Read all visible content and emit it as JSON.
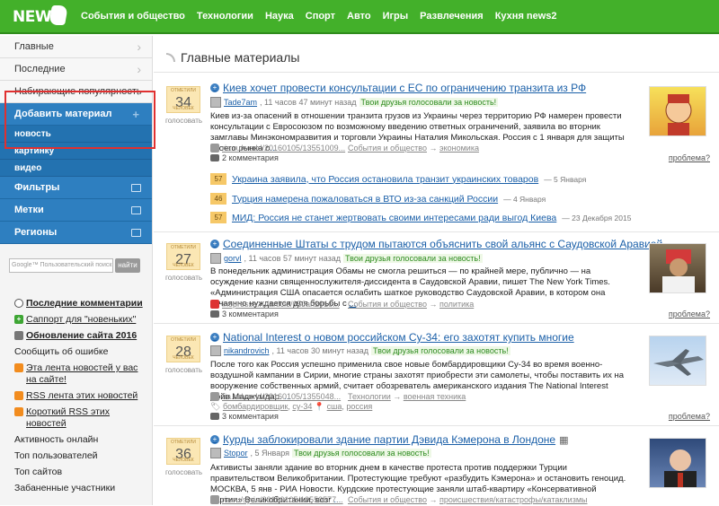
{
  "brand": {
    "logo_text": "NEWS",
    "accent": "#43b02a"
  },
  "nav": [
    "События и общество",
    "Технологии",
    "Наука",
    "Спорт",
    "Авто",
    "Игры",
    "Развлечения",
    "Кухня news2"
  ],
  "sidebar": {
    "items": [
      "Главные",
      "Последние",
      "Набирающие популярность"
    ],
    "add_material": "Добавить материал",
    "add_sub": [
      "новость",
      "картинку",
      "видео"
    ],
    "sections": [
      "Фильтры",
      "Метки",
      "Регионы"
    ],
    "search_placeholder": "Google™ Пользовательский поиск",
    "search_button": "найти",
    "links": [
      {
        "icon": "comment-icon",
        "label": "Последние комментарии",
        "bold": true
      },
      {
        "icon": "plus-icon",
        "label": "Саппорт для \"новеньких\"",
        "bold": false
      },
      {
        "icon": "document-icon",
        "label": "Обновление сайта 2016",
        "bold": true
      },
      {
        "icon": "",
        "label": "Сообщить об ошибке",
        "bold": false
      },
      {
        "icon": "rss-icon",
        "label": "Эта лента новостей у вас на сайте!",
        "bold": false
      },
      {
        "icon": "rss-icon",
        "label": "RSS лента этих новостей",
        "bold": false
      },
      {
        "icon": "rss-icon",
        "label": "Короткий RSS этих новостей",
        "bold": false
      },
      {
        "icon": "",
        "label": "Активность онлайн",
        "bold": false
      },
      {
        "icon": "",
        "label": "Топ пользователей",
        "bold": false
      },
      {
        "icon": "",
        "label": "Топ сайтов",
        "bold": false
      },
      {
        "icon": "",
        "label": "Забаненные участники",
        "bold": false
      }
    ]
  },
  "main": {
    "title": "Главные материалы",
    "vote_label": "голосовать",
    "vote_sup": "ОТМЕТИЛИ",
    "vote_sub": "ЧЕЛОВЕК",
    "friends_text": "Твои друзья голосовали за новость!",
    "problem_label": "проблема?",
    "articles": [
      {
        "votes": "34",
        "title": "Киев хочет провести консультации с ЕС по ограничению транзита из РФ",
        "user": "Tade7am",
        "time": ", 11 часов 47 минут назад",
        "body": "Киев из-за опасений в отношении транзита грузов из Украины через территорию РФ намерен провести консультации с Евросоюзом по возможному введению ответных ограничений, заявила во вторник замглавы Минэкономразвития и торговли Украины Наталия Микольская. Россия с 1 января для защиты своего рынка о",
        "more": "...",
        "source": "ria.ru/world/20160105/13551009...",
        "cat1": "События и общество",
        "arrow": "→",
        "cat2": "экономика",
        "tags": "",
        "comments": "2 комментария",
        "problem": "проблема?"
      },
      {
        "votes": "27",
        "title": "Соединенные Штаты с трудом пытаются объяснить свой альянс с Саудовской Аравией",
        "user": "gorvl",
        "time": ", 11 часов 57 минут назад",
        "body": "В понедельник администрация Обамы не смогла решиться — по крайней мере, публично — на осуждение казни священнослужителя-диссидента в Саудовской Аравии, пишет The New York Times. «Администрация США опасается ослабить шаткое руководство Саудовской Аравии, в котором она отчаянно нуждается для борьбы с",
        "more": "...",
        "source": "inopressa.ru/article/05Jan2016...",
        "cat1": "События и общество",
        "arrow": "→",
        "cat2": "политика",
        "tags": "",
        "comments": "3 комментария",
        "problem": "проблема?"
      },
      {
        "votes": "28",
        "title": "National Interest о новом российском Су-34: его захотят купить многие",
        "user": "nikandrovich",
        "time": ", 11 часов 30 минут назад",
        "body": "После того как Россия успешно применила свое новые бомбардировщики Су-34 во время военно-воздушной кампании в Сирии, многие страны захотят приобрести эти самолеты, чтобы поставить их на вооружение собственных армий, считает обозреватель американского издания The National Interest Дэйв Маджумдар.",
        "more": "...",
        "source": "ria.ru/world/20160105/1355048...",
        "cat1": "Технологии",
        "arrow": "→",
        "cat2": "военная техника",
        "tags": [
          "бомбардировщик",
          "су-34",
          "сша",
          "россия"
        ],
        "comments": "3 комментария",
        "problem": "проблема?"
      },
      {
        "votes": "36",
        "title": "Курды заблокировали здание партии Дэвида Кэмерона в Лондоне",
        "user": "Stopor",
        "time": ", 5 Января",
        "body": "Активисты заняли здание во вторник днем в качестве протеста против поддержки Турции правительством Великобритании. Протестующие требуют «разбудить Кэмерона» и остановить геноцид. МОСКВА, 5 янв - РИА Новости. Курдские протестующие заняли штаб-квартиру «Консервативной партии» Великобритании, возг",
        "more": "...",
        "source": "ria.ru/syria/20160105/13550577...",
        "cat1": "События и общество",
        "arrow": "→",
        "cat2": "происшествия/катастрофы/катаклизмы",
        "tags": "",
        "comments": "",
        "problem": ""
      }
    ],
    "related": [
      {
        "num": "57",
        "title": "Украина заявила, что Россия остановила транзит украинских товаров",
        "date": "— 5 Января"
      },
      {
        "num": "46",
        "title": "Турция намерена пожаловаться в ВТО из-за санкций России",
        "date": "— 4 Января"
      },
      {
        "num": "57",
        "title": "МИД: Россия не станет жертвовать своими интересами ради выгод Киева",
        "date": "— 23 Декабря 2015"
      }
    ]
  }
}
